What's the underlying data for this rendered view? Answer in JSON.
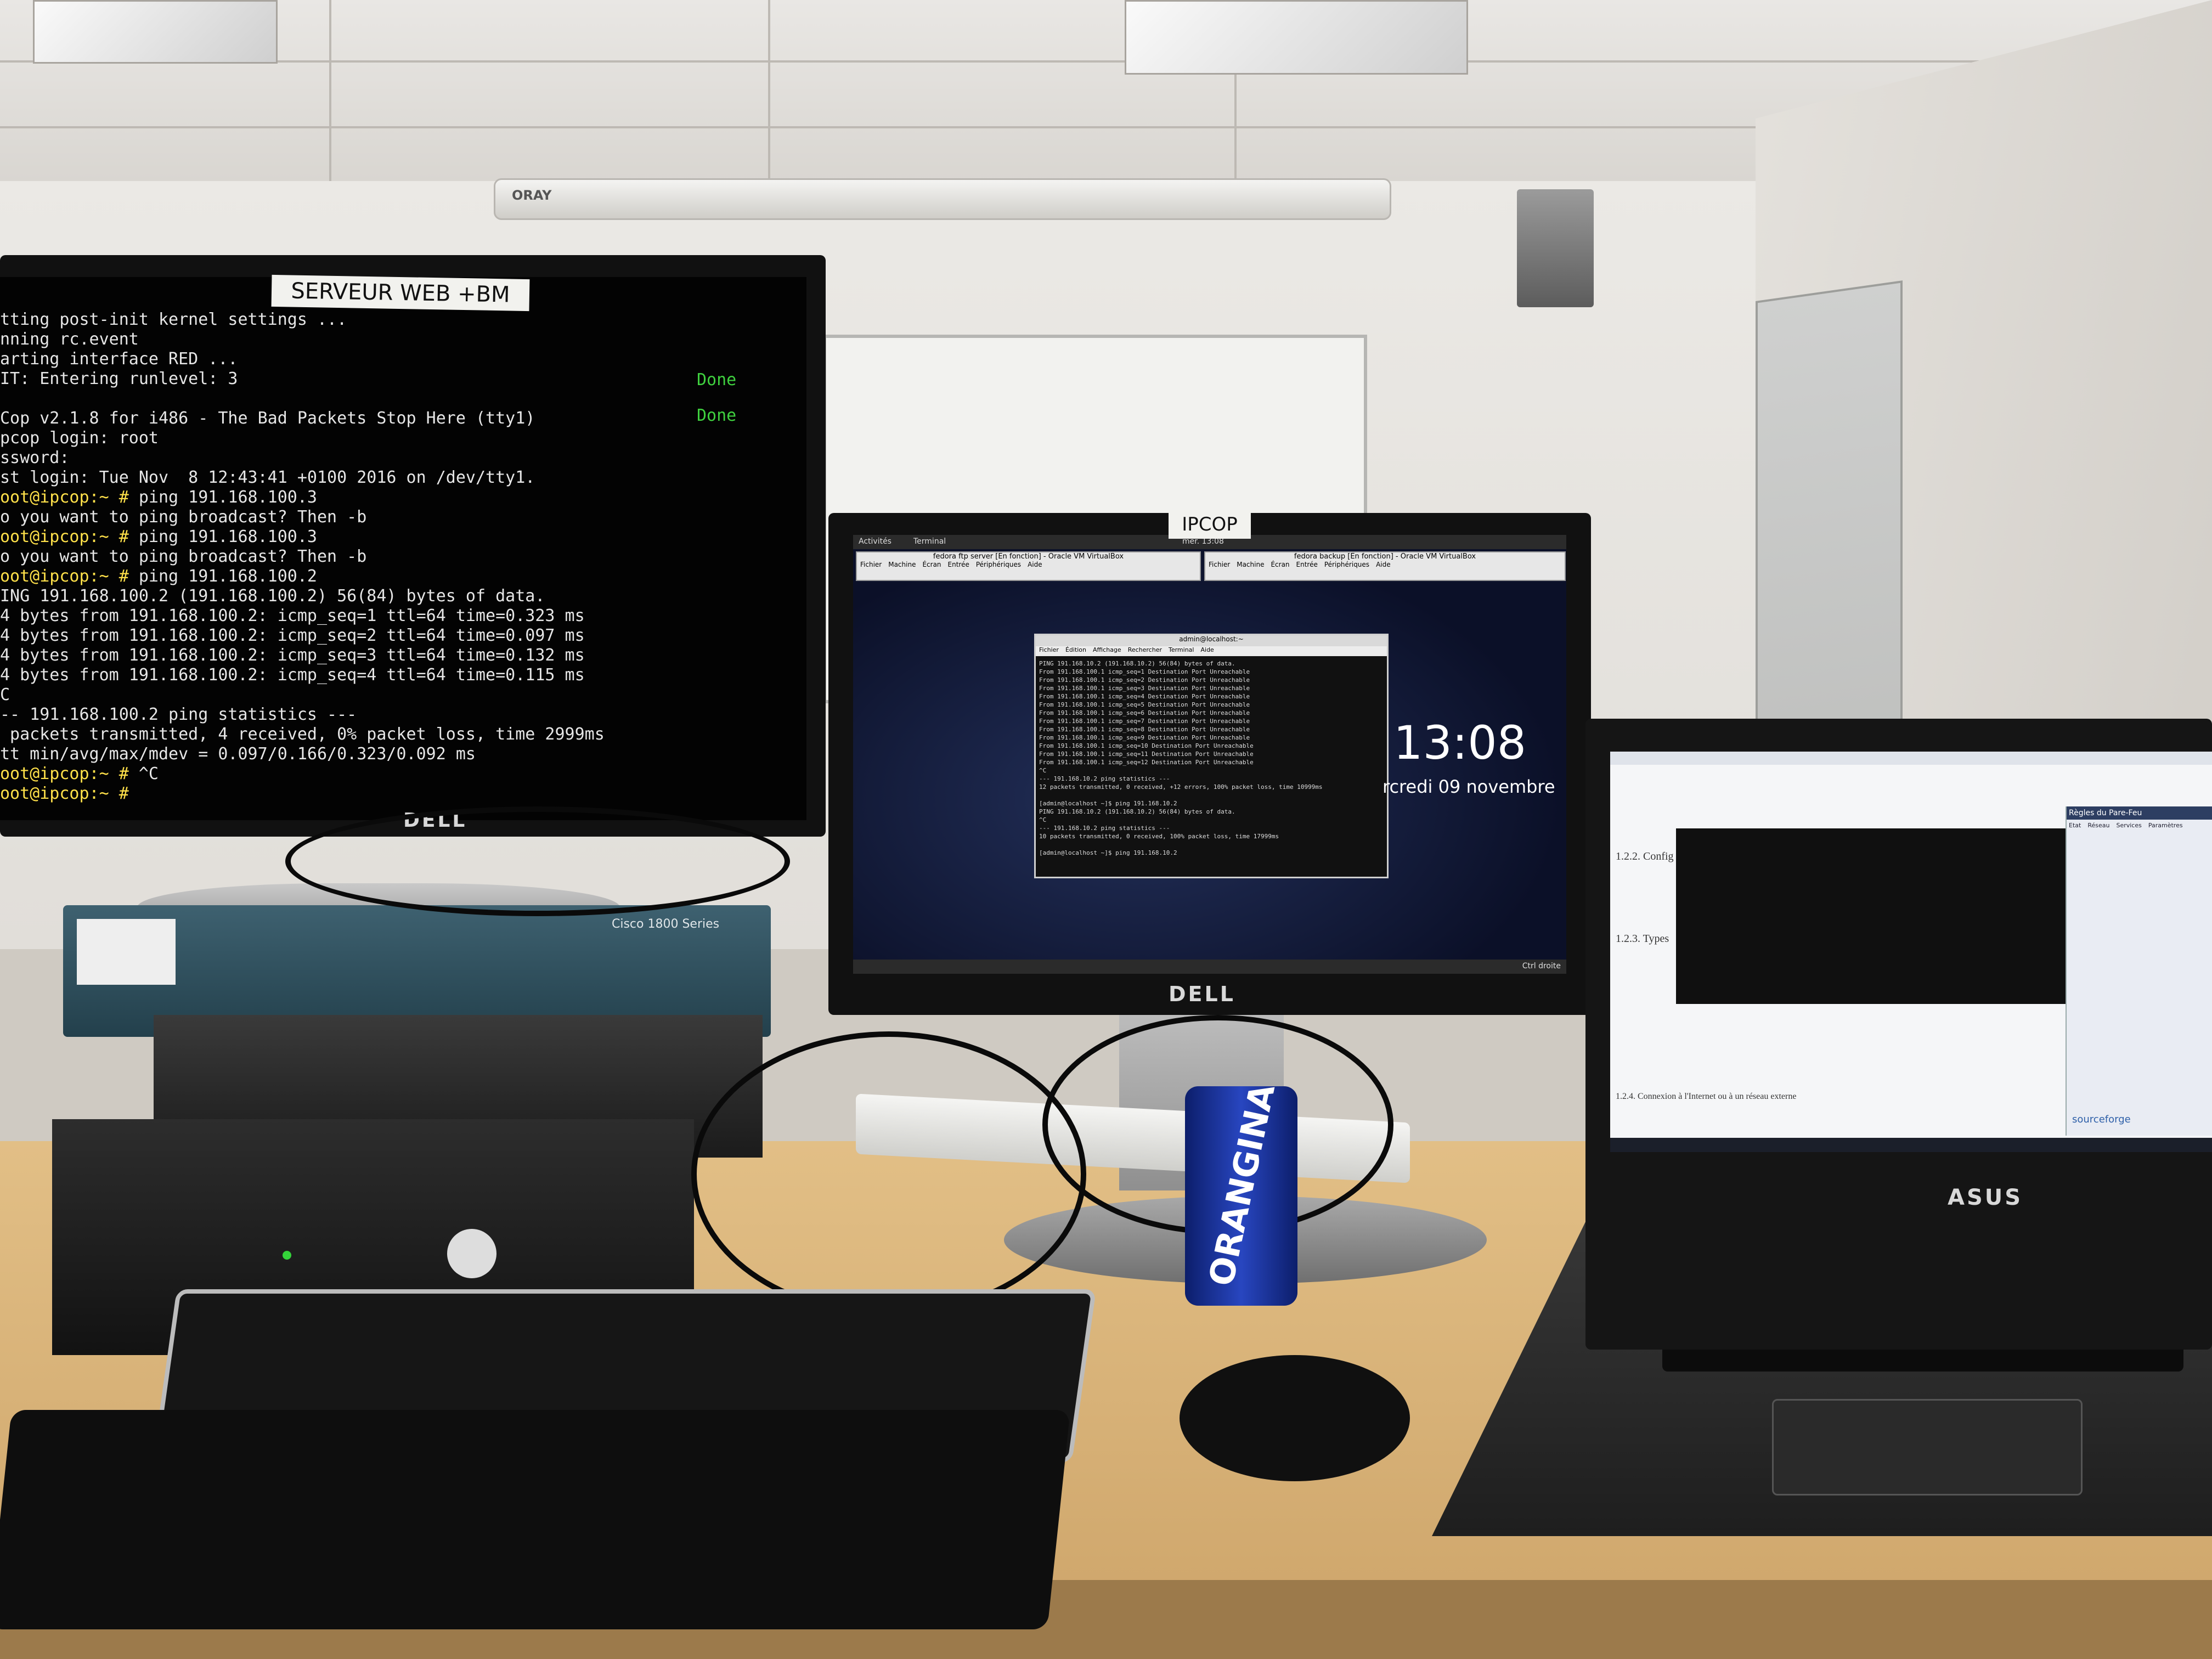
{
  "labels": {
    "left_monitor": "SERVEUR WEB +BM",
    "middle_monitor": "IPCOP"
  },
  "left_terminal": {
    "lines": [
      {
        "t": "tting post-init kernel settings ...",
        "c": "normal"
      },
      {
        "t": "nning rc.event",
        "c": "normal"
      },
      {
        "t": "arting interface RED ...",
        "c": "normal"
      },
      {
        "t": "IT: Entering runlevel: 3",
        "c": "normal"
      },
      {
        "t": "",
        "c": "normal"
      },
      {
        "t": "Cop v2.1.8 for i486 - The Bad Packets Stop Here (tty1)",
        "c": "normal"
      },
      {
        "t": "pcop login: root",
        "c": "normal"
      },
      {
        "t": "ssword:",
        "c": "normal"
      },
      {
        "t": "st login: Tue Nov  8 12:43:41 +0100 2016 on /dev/tty1.",
        "c": "normal"
      },
      {
        "t": "oot@ipcop:~ # ping 191.168.100.3",
        "c": "prompt"
      },
      {
        "t": "o you want to ping broadcast? Then -b",
        "c": "normal"
      },
      {
        "t": "oot@ipcop:~ # ping 191.168.100.3",
        "c": "prompt"
      },
      {
        "t": "o you want to ping broadcast? Then -b",
        "c": "normal"
      },
      {
        "t": "oot@ipcop:~ # ping 191.168.100.2",
        "c": "prompt"
      },
      {
        "t": "ING 191.168.100.2 (191.168.100.2) 56(84) bytes of data.",
        "c": "normal"
      },
      {
        "t": "4 bytes from 191.168.100.2: icmp_seq=1 ttl=64 time=0.323 ms",
        "c": "normal"
      },
      {
        "t": "4 bytes from 191.168.100.2: icmp_seq=2 ttl=64 time=0.097 ms",
        "c": "normal"
      },
      {
        "t": "4 bytes from 191.168.100.2: icmp_seq=3 ttl=64 time=0.132 ms",
        "c": "normal"
      },
      {
        "t": "4 bytes from 191.168.100.2: icmp_seq=4 ttl=64 time=0.115 ms",
        "c": "normal"
      },
      {
        "t": "C",
        "c": "normal"
      },
      {
        "t": "-- 191.168.100.2 ping statistics ---",
        "c": "normal"
      },
      {
        "t": " packets transmitted, 4 received, 0% packet loss, time 2999ms",
        "c": "normal"
      },
      {
        "t": "tt min/avg/max/mdev = 0.097/0.166/0.323/0.092 ms",
        "c": "normal"
      },
      {
        "t": "oot@ipcop:~ # ^C",
        "c": "prompt"
      },
      {
        "t": "oot@ipcop:~ #",
        "c": "prompt"
      }
    ],
    "done": [
      "Done",
      "Done"
    ]
  },
  "middle_screen": {
    "topbar_activities": "Activités",
    "topbar_app": "Terminal",
    "topbar_time": "mer. 13:08",
    "vm_title_1": "fedora ftp server [En fonction] - Oracle VM VirtualBox",
    "vm_title_2": "fedora backup [En fonction] - Oracle VM VirtualBox",
    "vm_menu": [
      "Fichier",
      "Machine",
      "Écran",
      "Entrée",
      "Périphériques",
      "Aide"
    ],
    "inner_title": "admin@localhost:~",
    "inner_menu": [
      "Fichier",
      "Édition",
      "Affichage",
      "Rechercher",
      "Terminal",
      "Aide"
    ],
    "inner_lines": [
      "PING 191.168.10.2 (191.168.10.2) 56(84) bytes of data.",
      "From 191.168.100.1 icmp_seq=1 Destination Port Unreachable",
      "From 191.168.100.1 icmp_seq=2 Destination Port Unreachable",
      "From 191.168.100.1 icmp_seq=3 Destination Port Unreachable",
      "From 191.168.100.1 icmp_seq=4 Destination Port Unreachable",
      "From 191.168.100.1 icmp_seq=5 Destination Port Unreachable",
      "From 191.168.100.1 icmp_seq=6 Destination Port Unreachable",
      "From 191.168.100.1 icmp_seq=7 Destination Port Unreachable",
      "From 191.168.100.1 icmp_seq=8 Destination Port Unreachable",
      "From 191.168.100.1 icmp_seq=9 Destination Port Unreachable",
      "From 191.168.100.1 icmp_seq=10 Destination Port Unreachable",
      "From 191.168.100.1 icmp_seq=11 Destination Port Unreachable",
      "From 191.168.100.1 icmp_seq=12 Destination Port Unreachable",
      "^C",
      "--- 191.168.10.2 ping statistics ---",
      "12 packets transmitted, 0 received, +12 errors, 100% packet loss, time 10999ms",
      "",
      "[admin@localhost ~]$ ping 191.168.10.2",
      "PING 191.168.10.2 (191.168.10.2) 56(84) bytes of data.",
      "^C",
      "--- 191.168.10.2 ping statistics ---",
      "10 packets transmitted, 0 received, 100% packet loss, time 17999ms",
      "",
      "[admin@localhost ~]$ ping 191.168.10.2"
    ],
    "clock_time": "13:08",
    "clock_date": "rcredi 09 novembre",
    "status_right": "Ctrl droite"
  },
  "laptop_screen": {
    "doc_headings": [
      "1.2.2. Config",
      "1.2.3. Types",
      "1.2.4. Connexion à l'Internet ou à un réseau externe"
    ],
    "sidebar_title": "Règles du Pare-Feu",
    "sidebar_cols": [
      "Etat",
      "Réseau",
      "Services",
      "Paramètres"
    ],
    "sourceforge": "sourceforge"
  },
  "objects": {
    "router_label": "Cisco 1800 Series",
    "can_text": "ORANGINA",
    "brand_dell": "DELL",
    "brand_asus": "ASUS",
    "brand_ceiling": "ORAY"
  },
  "colors": {
    "prompt": "#ffe14a",
    "done": "#3fd03f",
    "terminal_bg": "#030303",
    "can_blue": "#1a36a8"
  }
}
